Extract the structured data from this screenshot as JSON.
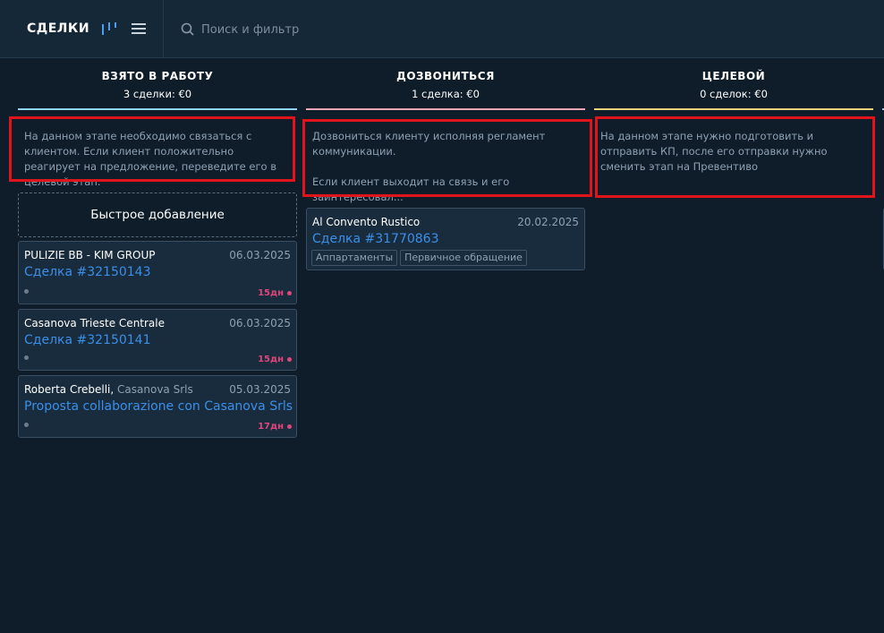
{
  "header": {
    "title": "СДЕЛКИ",
    "search_placeholder": "Поиск и фильтр"
  },
  "columns": [
    {
      "name": "ВЗЯТО В РАБОТУ",
      "summary": "3 сделки: €0",
      "color": "#8fd4f5",
      "description": "На данном этапе необходимо связаться с клиентом. Если клиент положительно реагирует на предложение, переведите его в целевой этап."
    },
    {
      "name": "ДОЗВОНИТЬСЯ",
      "summary": "1 сделка: €0",
      "color": "#f0a6b5",
      "description_line1": "Дозвониться клиенту исполняя регламент коммуникации.",
      "description_line2": "Если клиент выходит на связь и его заинтересовал..."
    },
    {
      "name": "ЦЕЛЕВОЙ",
      "summary": "0 сделок: €0",
      "color": "#f0d37a",
      "description": "На данном этапе нужно подготовить и отправить КП, после его отправки нужно сменить этап на Превентиво"
    }
  ],
  "quick_add_label": "Быстрое добавление",
  "cards": [
    {
      "contact": "PULIZIE BB - KIM GROUP",
      "company": "",
      "date": "06.03.2025",
      "deal": "Сделка #32150143",
      "days": "15дн"
    },
    {
      "contact": "Casanova Trieste Centrale",
      "company": "",
      "date": "06.03.2025",
      "deal": "Сделка #32150141",
      "days": "15дн"
    },
    {
      "contact": "Roberta Crebelli,",
      "company": "Casanova Srls",
      "date": "05.03.2025",
      "deal": "Proposta collaborazione con Casanova Srls",
      "days": "17дн"
    }
  ],
  "card_col2": {
    "contact": "Al Convento Rustico",
    "date": "20.02.2025",
    "deal": "Сделка #31770863",
    "tags": [
      "Аппартаменты",
      "Первичное обращение"
    ]
  },
  "colors": {
    "background": "#0f1d2a",
    "topbar": "#152838",
    "link": "#3b8fe8",
    "highlight": "#e0141b",
    "overdue": "#e0457e"
  }
}
